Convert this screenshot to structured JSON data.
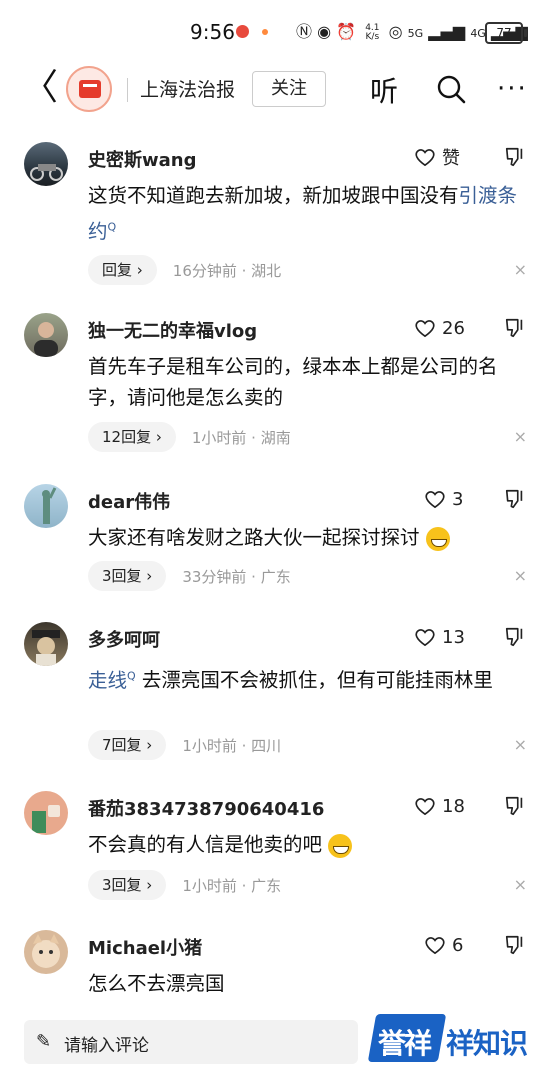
{
  "status_bar": {
    "time": "9:56",
    "net_speed_top": "4.1",
    "net_speed_bottom": "K/s",
    "signal_1": "5G",
    "signal_2": "4G",
    "battery": "77"
  },
  "header": {
    "back_glyph": "〈",
    "publisher": "上海法治报",
    "follow_label": "关注",
    "listen_label": "听",
    "more_glyph": "···"
  },
  "comments": [
    {
      "user": "史密斯wang",
      "like": "赞",
      "text_pre": "这货不知道跑去新加坡，新加坡跟中国没有",
      "link": "引渡条约",
      "text_post": "",
      "reply": "回复 ›",
      "meta": "16分钟前 · 湖北"
    },
    {
      "user": "独一无二的幸福vlog",
      "like": "26",
      "text_pre": "首先车子是租车公司的，绿本本上都是公司的名字，请问他是怎么卖的",
      "link": "",
      "text_post": "",
      "reply": "12回复 ›",
      "meta": "1小时前 · 湖南"
    },
    {
      "user": "dear伟伟",
      "like": "3",
      "text_pre": "大家还有啥发财之路大伙一起探讨探讨",
      "link": "",
      "text_post": "",
      "reply": "3回复 ›",
      "meta": "33分钟前 · 广东"
    },
    {
      "user": "多多呵呵",
      "like": "13",
      "text_pre": "",
      "link": "走线",
      "text_post": " 去漂亮国不会被抓住，但有可能挂雨林里",
      "reply": "7回复 ›",
      "meta": "1小时前 · 四川"
    },
    {
      "user": "番茄3834738790640416",
      "like": "18",
      "text_pre": "不会真的有人信是他卖的吧",
      "link": "",
      "text_post": "",
      "reply": "3回复 ›",
      "meta": "1小时前 · 广东"
    },
    {
      "user": "Michael小猪",
      "like": "6",
      "text_pre": "怎么不去漂亮国",
      "link": "",
      "text_post": "",
      "reply": "",
      "meta": ""
    }
  ],
  "close_glyph": "×",
  "input": {
    "placeholder": "请输入评论",
    "pen_glyph": "✎"
  },
  "watermark": {
    "part1": "誉祥",
    "part2": "祥知识"
  },
  "colors": {
    "link": "#3a5f96",
    "accent_red": "#e53b2c",
    "watermark_blue": "#1a62c4"
  }
}
